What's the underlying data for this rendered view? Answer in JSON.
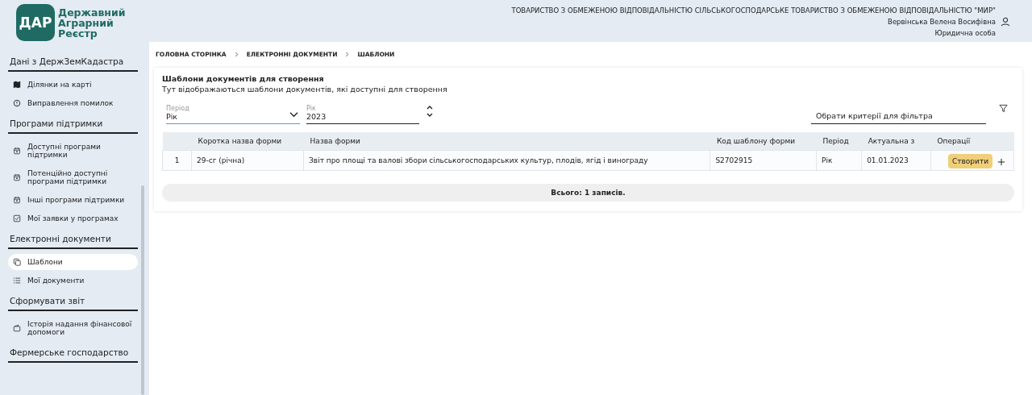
{
  "logo": {
    "mark": "ДАР",
    "name": [
      "Державний",
      "Аграрний",
      "Реєстр"
    ]
  },
  "header": {
    "organization": "ТОВАРИСТВО З ОБМЕЖЕНОЮ ВІДПОВІДАЛЬНІСТЮ СІЛЬСЬКОГОСПОДАРСЬКЕ ТОВАРИСТВО З ОБМЕЖЕНОЮ ВІДПОВІДАЛЬНІСТЮ \"МИР\"",
    "user": "Вервінська Велена Восифівна",
    "role": "Юридична особа"
  },
  "sidebar": {
    "sections": [
      {
        "title": "Дані з ДержЗемКадастра",
        "items": [
          {
            "label": "Ділянки на карті",
            "kind": "map",
            "selected": false
          },
          {
            "label": "Виправлення помилок",
            "kind": "alert",
            "selected": false
          }
        ]
      },
      {
        "title": "Програми підтримки",
        "items": [
          {
            "label": "Доступні програми підтримки",
            "kind": "calendar",
            "selected": false
          },
          {
            "label": "Потенційно доступні програми підтримки",
            "kind": "calendar",
            "selected": false
          },
          {
            "label": "Інші програми підтримки",
            "kind": "calendar",
            "selected": false
          },
          {
            "label": "Мої заявки у програмах",
            "kind": "check",
            "selected": false
          }
        ]
      },
      {
        "title": "Електронні документи",
        "items": [
          {
            "label": "Шаблони",
            "kind": "copy",
            "selected": true
          },
          {
            "label": "Мої документи",
            "kind": "list",
            "selected": false
          }
        ]
      },
      {
        "title": "Сформувати звіт",
        "items": [
          {
            "label": "Історія надання фінансової допомоги",
            "kind": "wallet",
            "selected": false
          }
        ]
      },
      {
        "title": "Фермерське господарство"
      }
    ]
  },
  "breadcrumbs": [
    "ГОЛОВНА СТОРІНКА",
    "ЕЛЕКТРОННІ ДОКУМЕНТИ",
    "ШАБЛОНИ"
  ],
  "panel": {
    "title": "Шаблони документів для створення",
    "subtitle": "Тут відображаються шаблони документів, які доступні для створення",
    "period": {
      "label": "Період",
      "value": "Рік"
    },
    "year": {
      "label": "Рік",
      "value": "2023"
    },
    "filter": {
      "placeholder": "Обрати критерії для фільтра"
    },
    "table": {
      "columns": [
        "Коротка назва форми",
        "Назва форми",
        "Код шаблону форми",
        "Період",
        "Актуальна з",
        "Операції"
      ],
      "rows": [
        {
          "number": "1",
          "cells": [
            "29-сг (річна)",
            "Звіт про площі та валові збори сільськогосподарських культур, плодів, ягід і винограду",
            "S2702915",
            "Рік",
            "01.01.2023"
          ]
        }
      ]
    },
    "tooltip": "Створити",
    "total": "Всього: 1 записів."
  }
}
